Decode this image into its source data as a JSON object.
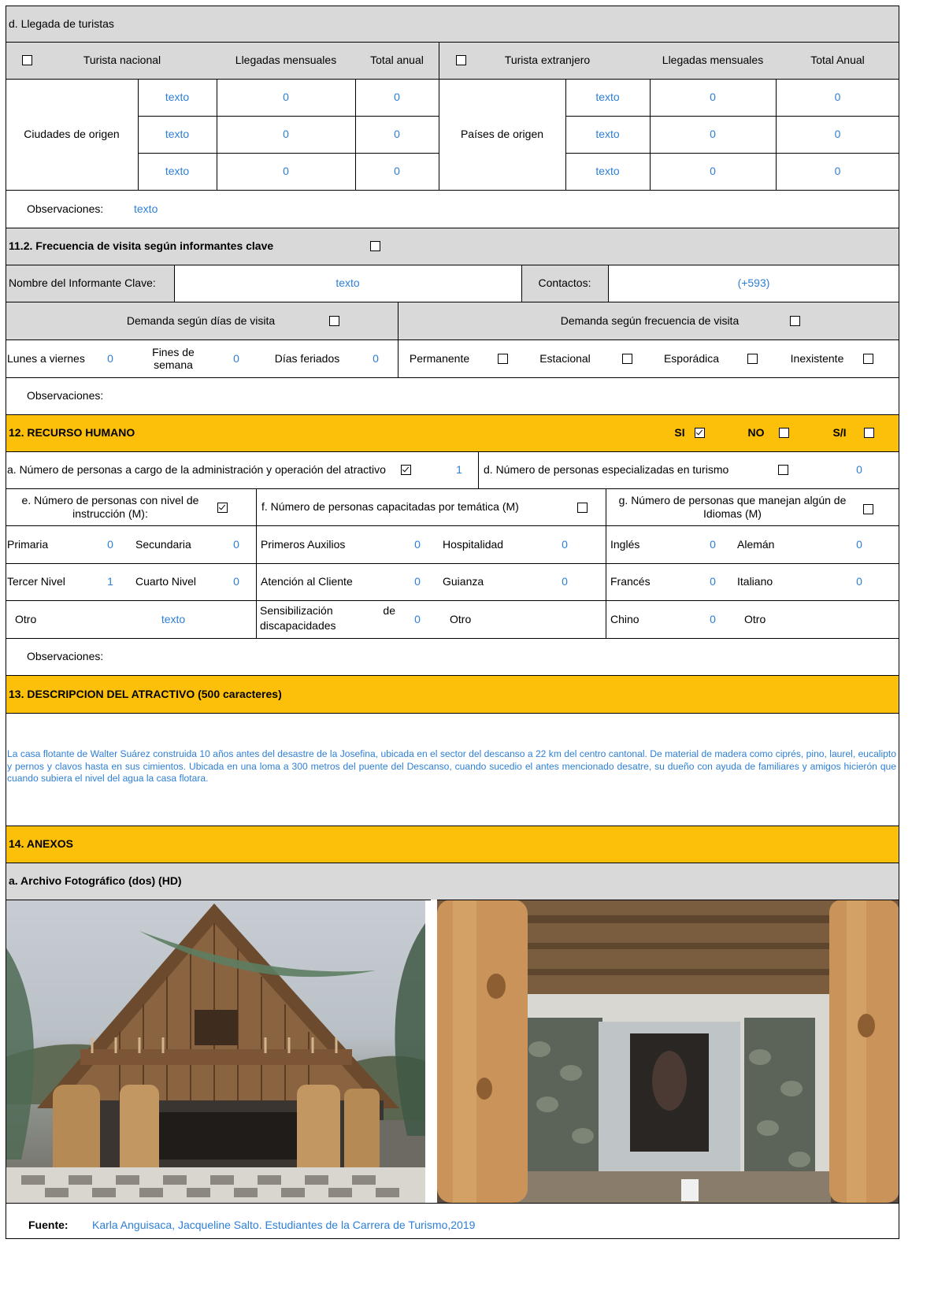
{
  "tourist_arrivals": {
    "title": "d. Llegada de turistas",
    "national_label": "Turista nacional",
    "monthly_label": "Llegadas mensuales",
    "annual_label": "Total anual",
    "foreign_label": "Turista extranjero",
    "foreign_monthly_label": "Llegadas mensuales",
    "foreign_annual_label": "Total Anual",
    "cities_label": "Ciudades de origen",
    "countries_label": "Países de origen",
    "national_rows": [
      {
        "origin": "texto",
        "monthly": "0",
        "annual": "0"
      },
      {
        "origin": "texto",
        "monthly": "0",
        "annual": "0"
      },
      {
        "origin": "texto",
        "monthly": "0",
        "annual": "0"
      }
    ],
    "foreign_rows": [
      {
        "origin": "texto",
        "monthly": "0",
        "annual": "0"
      },
      {
        "origin": "texto",
        "monthly": "0",
        "annual": "0"
      },
      {
        "origin": "texto",
        "monthly": "0",
        "annual": "0"
      }
    ],
    "observations_label": "Observaciones:",
    "observations_value": "texto"
  },
  "visit_frequency": {
    "title": "11.2. Frecuencia de visita según informantes clave",
    "informant_label": "Nombre del Informante Clave:",
    "informant_value": "texto",
    "contacts_label": "Contactos:",
    "contacts_value": "(+593)",
    "demand_days_label": "Demanda según  días de visita",
    "demand_freq_label": "Demanda según frecuencia de visita",
    "weekdays_label": "Lunes a viernes",
    "weekdays_value": "0",
    "weekends_label": "Fines de semana",
    "weekends_value": "0",
    "holidays_label": "Días feriados",
    "holidays_value": "0",
    "permanent_label": "Permanente",
    "seasonal_label": "Estacional",
    "sporadic_label": "Esporádica",
    "nonexistent_label": "Inexistente",
    "observations_label": "Observaciones:"
  },
  "human_resources": {
    "title": "12. RECURSO HUMANO",
    "si_label": "SI",
    "si_checked": true,
    "no_label": "NO",
    "sn_label": "S/I",
    "admin_label": "a. Número de personas a cargo de la administración y operación del atractivo",
    "admin_checked": true,
    "admin_value": "1",
    "tourism_label": "d. Número de personas especializadas en turismo",
    "tourism_value": "0",
    "education_label": "e. Número de personas con nivel de instrucción (M):",
    "education_checked": true,
    "trained_label": "f. Número de personas capacitadas por temática (M)",
    "languages_label": "g. Número de personas que manejan algún de Idiomas (M)",
    "primary_label": "Primaria",
    "primary_value": "0",
    "secondary_label": "Secundaria",
    "secondary_value": "0",
    "first_aid_label": "Primeros Auxilios",
    "first_aid_value": "0",
    "hospitality_label": "Hospitalidad",
    "hospitality_value": "0",
    "english_label": "Inglés",
    "english_value": "0",
    "german_label": "Alemán",
    "german_value": "0",
    "third_level_label": "Tercer Nivel",
    "third_level_value": "1",
    "fourth_level_label": "Cuarto Nivel",
    "fourth_level_value": "0",
    "customer_service_label": "Atención al Cliente",
    "customer_service_value": "0",
    "guiding_label": "Guianza",
    "guiding_value": "0",
    "french_label": "Francés",
    "french_value": "0",
    "italian_label": "Italiano",
    "italian_value": "0",
    "other_label": "Otro",
    "other_value": "texto",
    "disability_label_a": "Sensibilización",
    "disability_label_de": "de",
    "disability_label_b": "discapacidades",
    "disability_value": "0",
    "other_topic_label": "Otro",
    "chinese_label": "Chino",
    "chinese_value": "0",
    "other_language_label": "Otro",
    "observations_label": "Observaciones:"
  },
  "description": {
    "title": "13. DESCRIPCION DEL ATRACTIVO (500 caracteres)",
    "text": "La casa flotante de Walter Suárez construida 10 años antes del desastre de la Josefina, ubicada en el sector del descanso a 22 km del centro cantonal. De material de madera como ciprés, pino, laurel, eucalipto y pernos y clavos hasta en sus cimientos.  Ubicada en una loma a 300 metros del puente del Descanso, cuando sucedio el antes mencionado desatre, su dueño con ayuda de familiares y amigos hicierón que cuando subiera el nivel del agua la casa flotara."
  },
  "annexes": {
    "title": "14. ANEXOS",
    "photo_archive_label": "a. Archivo Fotográfico (dos) (HD)",
    "source_label": "Fuente:",
    "source_value": "Karla Anguisaca, Jacqueline Salto. Estudiantes de la Carrera de Turismo,2019"
  },
  "colors": {
    "header_gray": "#d9d9d9",
    "section_orange": "#fdc00a",
    "value_blue": "#2d7fd6"
  }
}
